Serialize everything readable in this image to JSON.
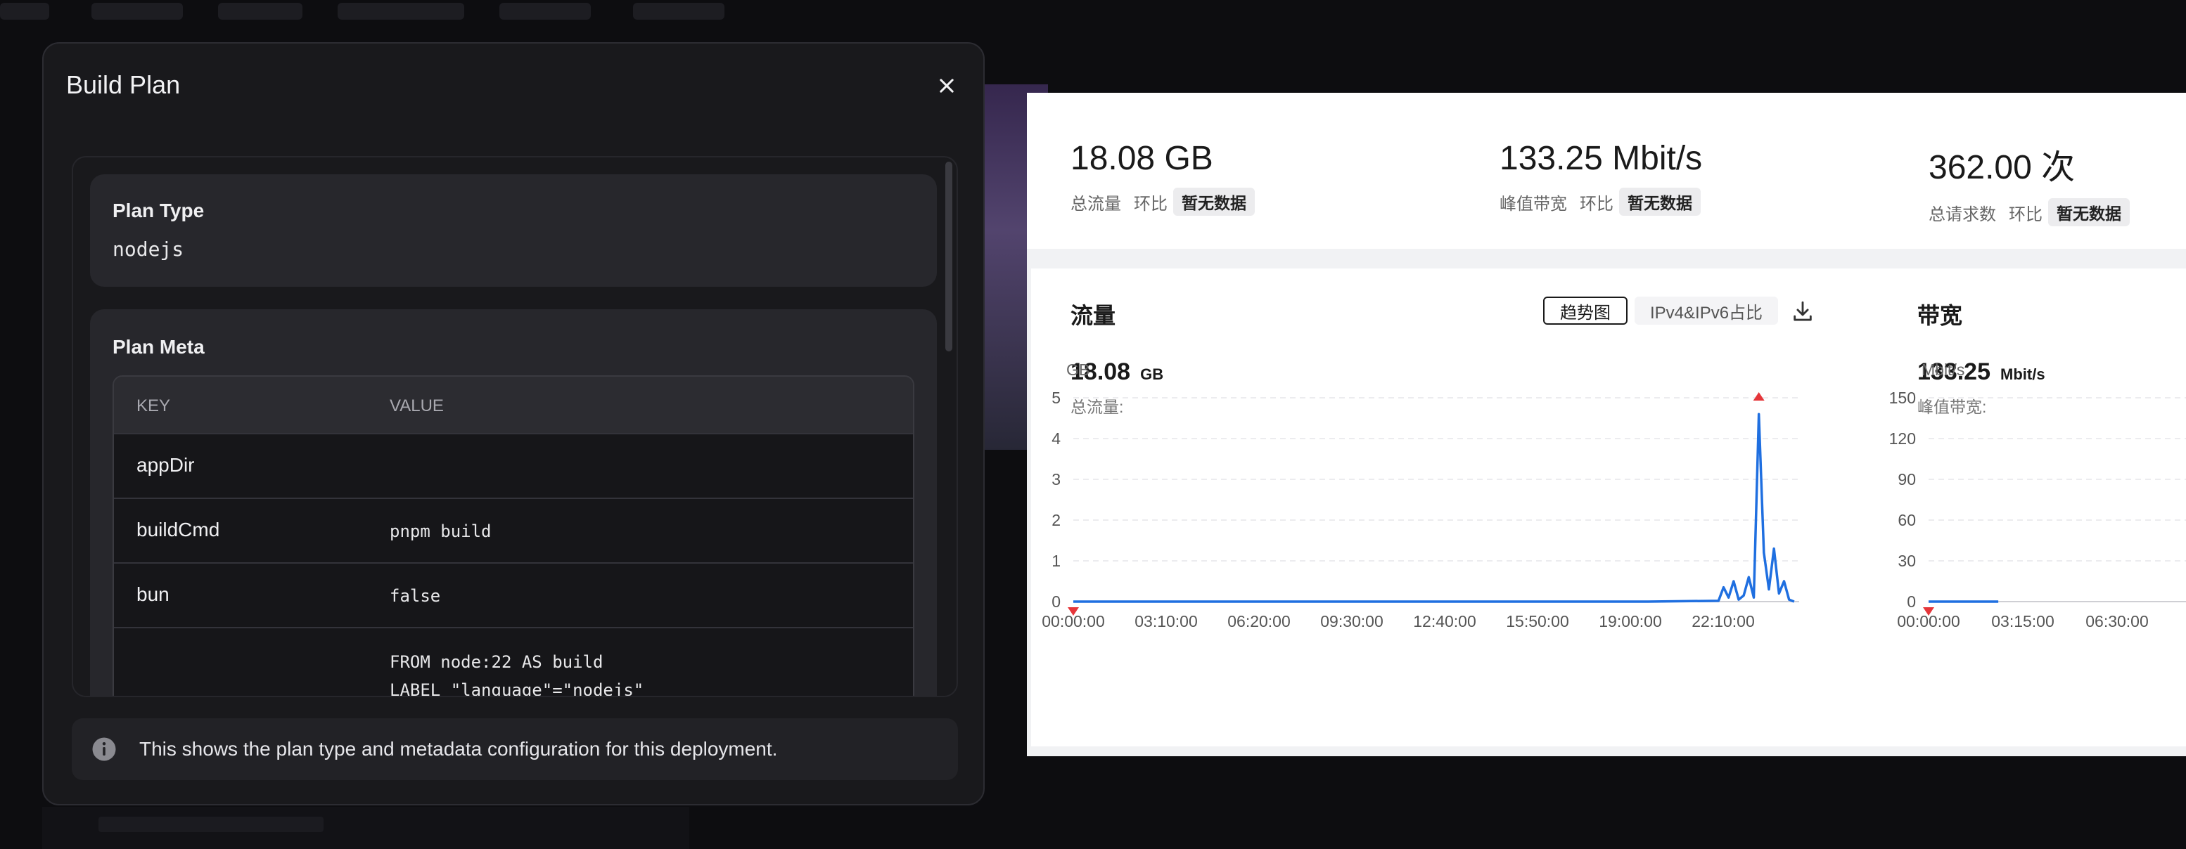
{
  "modal": {
    "title": "Build Plan",
    "close_icon": "close-icon",
    "plan_type": {
      "label": "Plan Type",
      "value": "nodejs"
    },
    "plan_meta": {
      "label": "Plan Meta",
      "headers": [
        "KEY",
        "VALUE"
      ],
      "rows": [
        {
          "key": "appDir",
          "value": ""
        },
        {
          "key": "buildCmd",
          "value": "pnpm build"
        },
        {
          "key": "bun",
          "value": "false"
        },
        {
          "key": "",
          "value": "FROM node:22 AS build\nLABEL \"language\"=\"nodejs\""
        }
      ]
    },
    "info": {
      "icon": "info-icon",
      "text": "This shows the plan type and metadata configuration for this deployment."
    }
  },
  "stats": [
    {
      "value": "18.08 GB",
      "label": "总流量",
      "ratio_label": "环比",
      "badge": "暂无数据"
    },
    {
      "value": "133.25 Mbit/s",
      "label": "峰值带宽",
      "ratio_label": "环比",
      "badge": "暂无数据"
    },
    {
      "value": "362.00 次",
      "label": "总请求数",
      "ratio_label": "环比",
      "badge": "暂无数据"
    }
  ],
  "traffic_panel": {
    "title": "流量",
    "tabs": [
      "趋势图",
      "IPv4&IPv6占比"
    ],
    "active_tab": "趋势图",
    "download_icon": "download-icon",
    "total_value": "18.08",
    "total_unit": "GB",
    "total_label": "总流量:"
  },
  "bandwidth_panel": {
    "title": "带宽",
    "peak_value": "133.25",
    "peak_unit": "Mbit/s",
    "peak_label": "峰值带宽:"
  },
  "colors": {
    "line": "#1f6fe0",
    "marker": "#e5363a"
  },
  "chart_data": [
    {
      "type": "line",
      "ylabel": "GB",
      "ylim": [
        0,
        5
      ],
      "yticks": [
        0,
        1,
        2,
        3,
        4,
        5
      ],
      "xticks": [
        "00:00:00",
        "03:10:00",
        "06:20:00",
        "09:30:00",
        "12:40:00",
        "15:50:00",
        "19:00:00",
        "22:10:00"
      ],
      "grid": true,
      "x": [
        "00:00:00",
        "03:10:00",
        "06:20:00",
        "09:30:00",
        "12:40:00",
        "15:50:00",
        "19:00:00",
        "21:20:00",
        "21:30:00",
        "21:40:00",
        "21:50:00",
        "22:00:00",
        "22:10:00",
        "22:20:00",
        "22:30:00",
        "22:40:00",
        "22:50:00",
        "23:00:00",
        "23:10:00",
        "23:20:00",
        "23:30:00",
        "23:40:00",
        "23:50:00"
      ],
      "values": [
        0,
        0,
        0,
        0,
        0,
        0,
        0,
        0.02,
        0.35,
        0.1,
        0.5,
        0.05,
        0.15,
        0.6,
        0.1,
        4.6,
        1.2,
        0.3,
        1.3,
        0.2,
        0.5,
        0.05,
        0
      ],
      "markers": [
        {
          "x": "00:00:00",
          "y": 0,
          "direction": "down"
        },
        {
          "x": "22:40:00",
          "y": 5,
          "direction": "up"
        }
      ]
    },
    {
      "type": "line",
      "ylabel": "Mbit/s",
      "ylim": [
        0,
        150
      ],
      "yticks": [
        0,
        30,
        60,
        90,
        120,
        150
      ],
      "xticks": [
        "00:00:00",
        "03:15:00",
        "06:30:00"
      ],
      "grid": true,
      "x": [
        "00:00:00",
        "06:30:00"
      ],
      "values": [
        0,
        0
      ],
      "markers": [
        {
          "x": "00:00:00",
          "y": 0,
          "direction": "down"
        }
      ]
    }
  ]
}
